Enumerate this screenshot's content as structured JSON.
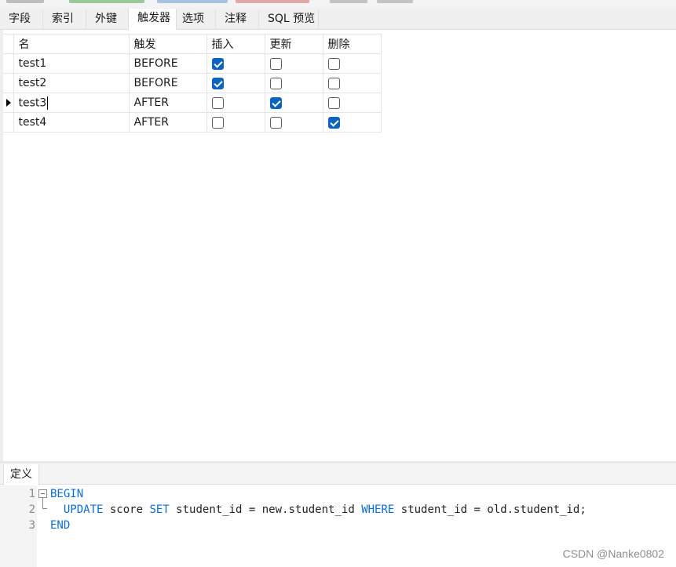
{
  "tabs": [
    {
      "label": "字段"
    },
    {
      "label": "索引"
    },
    {
      "label": "外键"
    },
    {
      "label": "触发器"
    },
    {
      "label": "选项"
    },
    {
      "label": "注释"
    },
    {
      "label": "SQL 预览"
    }
  ],
  "active_tab": "触发器",
  "grid": {
    "headers": [
      "名",
      "触发",
      "插入",
      "更新",
      "删除"
    ],
    "rows": [
      {
        "name": "test1",
        "timing": "BEFORE",
        "insert": true,
        "update": false,
        "delete": false
      },
      {
        "name": "test2",
        "timing": "BEFORE",
        "insert": true,
        "update": false,
        "delete": false
      },
      {
        "name": "test3",
        "timing": "AFTER",
        "insert": false,
        "update": true,
        "delete": false
      },
      {
        "name": "test4",
        "timing": "AFTER",
        "insert": false,
        "update": false,
        "delete": true
      }
    ],
    "current_row": 2
  },
  "definition": {
    "tab_label": "定义",
    "line_numbers": [
      "1",
      "2",
      "3"
    ],
    "code": {
      "l1_kw": "BEGIN",
      "l2_kw1": "UPDATE",
      "l2_t1": " score ",
      "l2_kw2": "SET",
      "l2_t2": " student_id = new.student_id ",
      "l2_kw3": "WHERE",
      "l2_t3": " student_id = old.student_id;",
      "l3_kw": "END"
    }
  },
  "watermark": "CSDN @Nanke0802",
  "colors": {
    "checkbox_on": "#0a64c2",
    "keyword": "#0b6cd4"
  }
}
